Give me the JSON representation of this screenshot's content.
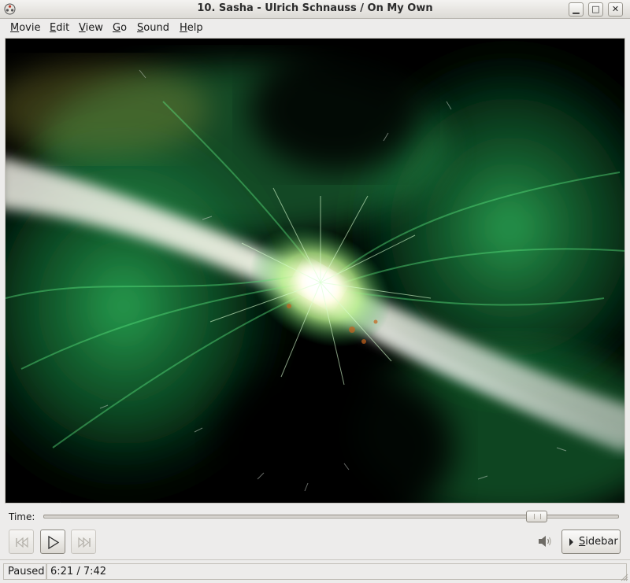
{
  "window": {
    "title": "10. Sasha - Ulrich Schnauss / On My Own",
    "app_icon": "totem-film-reel-icon",
    "controls": {
      "minimize": "▁",
      "maximize": "□",
      "close": "✕"
    }
  },
  "menubar": {
    "items": [
      {
        "label": "Movie",
        "access": "M"
      },
      {
        "label": "Edit",
        "access": "E"
      },
      {
        "label": "View",
        "access": "V"
      },
      {
        "label": "Go",
        "access": "G"
      },
      {
        "label": "Sound",
        "access": "S"
      },
      {
        "label": "Help",
        "access": "H"
      }
    ]
  },
  "video": {
    "content": "audio visualization",
    "colors": {
      "glow": "#3bd16a",
      "core": "#fffbe0",
      "band": "#e8f0e6",
      "background": "#000000"
    }
  },
  "seek": {
    "label": "Time:",
    "position": 0.857
  },
  "controls": {
    "previous_icon": "skip-previous-icon",
    "play_icon": "play-icon",
    "next_icon": "skip-next-icon",
    "volume_icon": "volume-icon",
    "sidebar_label": "Sidebar"
  },
  "status": {
    "state": "Paused",
    "time": "6:21 / 7:42"
  }
}
